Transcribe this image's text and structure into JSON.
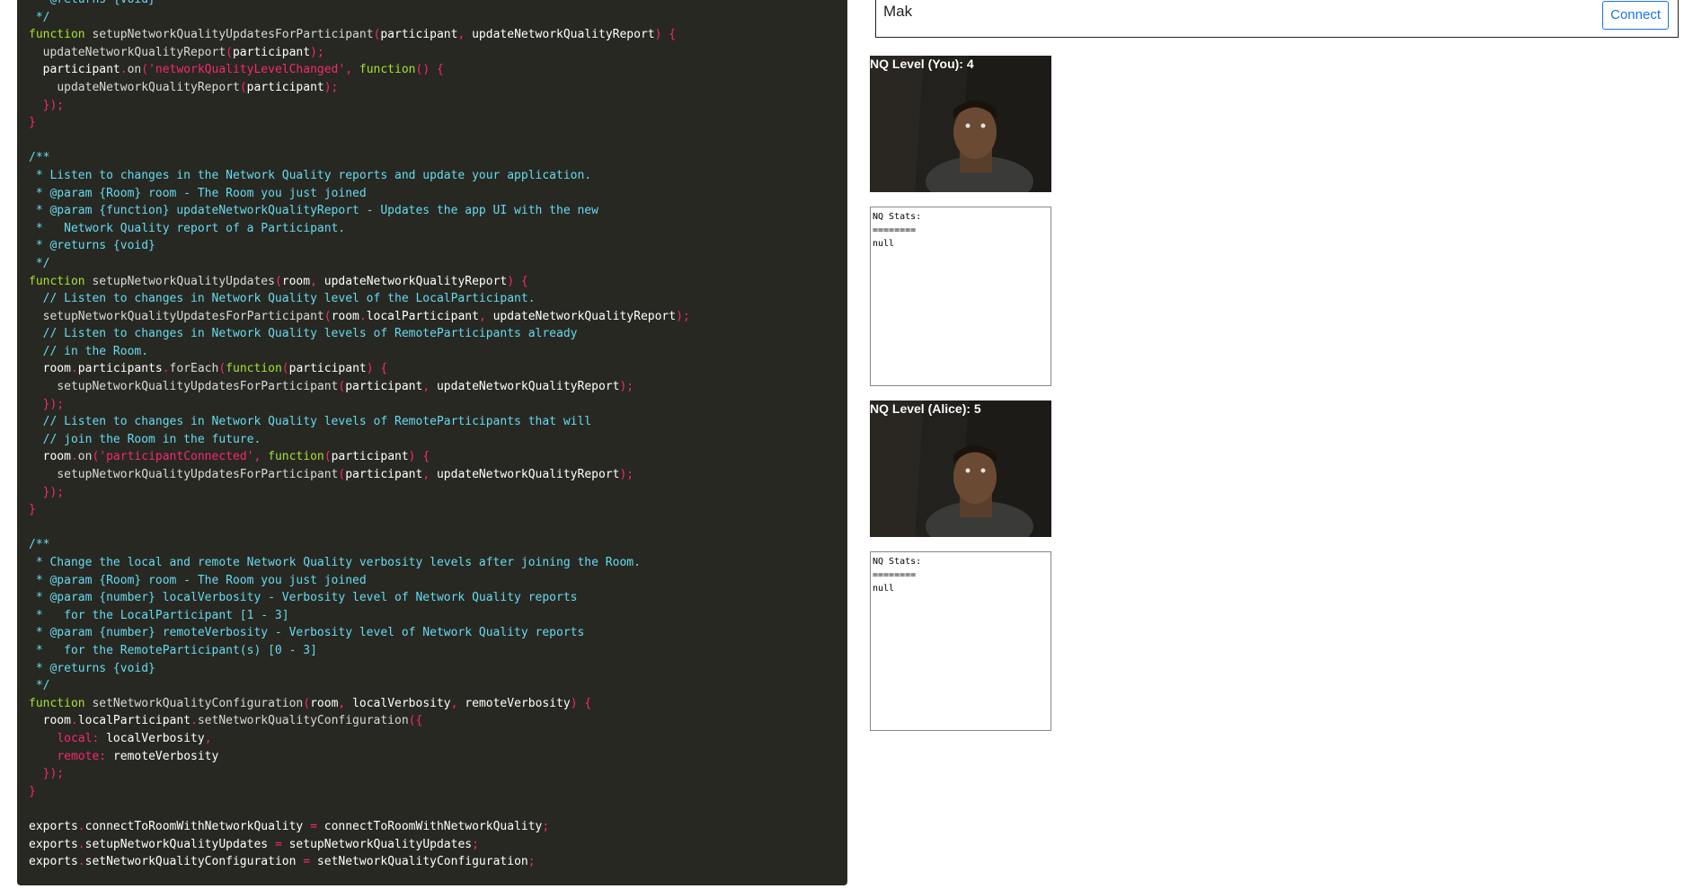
{
  "code_lines": [
    [
      [
        " * @returns {void}",
        "c"
      ]
    ],
    [
      [
        " */",
        "c"
      ]
    ],
    [
      [
        "function",
        "kw"
      ],
      [
        " ",
        ""
      ],
      [
        "setupNetworkQualityUpdatesForParticipant",
        "fn"
      ],
      [
        "(",
        "p"
      ],
      [
        "participant",
        "id"
      ],
      [
        ", ",
        "p"
      ],
      [
        "updateNetworkQualityReport",
        "id"
      ],
      [
        ") {",
        "p"
      ]
    ],
    [
      [
        "  ",
        ""
      ],
      [
        "updateNetworkQualityReport",
        "fn"
      ],
      [
        "(",
        "p"
      ],
      [
        "participant",
        "id"
      ],
      [
        ");",
        "p"
      ]
    ],
    [
      [
        "  ",
        ""
      ],
      [
        "participant",
        "id"
      ],
      [
        ".",
        "p"
      ],
      [
        "on",
        "fn"
      ],
      [
        "(",
        "p"
      ],
      [
        "'networkQualityLevelChanged'",
        "str"
      ],
      [
        ", ",
        "p"
      ],
      [
        "function",
        "kw"
      ],
      [
        "() {",
        "p"
      ]
    ],
    [
      [
        "    ",
        ""
      ],
      [
        "updateNetworkQualityReport",
        "fn"
      ],
      [
        "(",
        "p"
      ],
      [
        "participant",
        "id"
      ],
      [
        ");",
        "p"
      ]
    ],
    [
      [
        "  });",
        "p"
      ]
    ],
    [
      [
        "}",
        "p"
      ]
    ],
    [
      [
        "",
        ""
      ]
    ],
    [
      [
        "/**",
        "c"
      ]
    ],
    [
      [
        " * Listen to changes in the Network Quality reports and update your application.",
        "c"
      ]
    ],
    [
      [
        " * @param {Room} room - The Room you just joined",
        "c"
      ]
    ],
    [
      [
        " * @param {function} updateNetworkQualityReport - Updates the app UI with the new",
        "c"
      ]
    ],
    [
      [
        " *   Network Quality report of a Participant.",
        "c"
      ]
    ],
    [
      [
        " * @returns {void}",
        "c"
      ]
    ],
    [
      [
        " */",
        "c"
      ]
    ],
    [
      [
        "function",
        "kw"
      ],
      [
        " ",
        ""
      ],
      [
        "setupNetworkQualityUpdates",
        "fn"
      ],
      [
        "(",
        "p"
      ],
      [
        "room",
        "id"
      ],
      [
        ", ",
        "p"
      ],
      [
        "updateNetworkQualityReport",
        "id"
      ],
      [
        ") {",
        "p"
      ]
    ],
    [
      [
        "  // Listen to changes in Network Quality level of the LocalParticipant.",
        "c"
      ]
    ],
    [
      [
        "  ",
        ""
      ],
      [
        "setupNetworkQualityUpdatesForParticipant",
        "fn"
      ],
      [
        "(",
        "p"
      ],
      [
        "room",
        "id"
      ],
      [
        ".",
        "p"
      ],
      [
        "localParticipant",
        "id"
      ],
      [
        ", ",
        "p"
      ],
      [
        "updateNetworkQualityReport",
        "id"
      ],
      [
        ");",
        "p"
      ]
    ],
    [
      [
        "  // Listen to changes in Network Quality levels of RemoteParticipants already",
        "c"
      ]
    ],
    [
      [
        "  // in the Room.",
        "c"
      ]
    ],
    [
      [
        "  ",
        ""
      ],
      [
        "room",
        "id"
      ],
      [
        ".",
        "p"
      ],
      [
        "participants",
        "id"
      ],
      [
        ".",
        "p"
      ],
      [
        "forEach",
        "fn"
      ],
      [
        "(",
        "p"
      ],
      [
        "function",
        "kw"
      ],
      [
        "(",
        "p"
      ],
      [
        "participant",
        "id"
      ],
      [
        ") {",
        "p"
      ]
    ],
    [
      [
        "    ",
        ""
      ],
      [
        "setupNetworkQualityUpdatesForParticipant",
        "fn"
      ],
      [
        "(",
        "p"
      ],
      [
        "participant",
        "id"
      ],
      [
        ", ",
        "p"
      ],
      [
        "updateNetworkQualityReport",
        "id"
      ],
      [
        ");",
        "p"
      ]
    ],
    [
      [
        "  });",
        "p"
      ]
    ],
    [
      [
        "  // Listen to changes in Network Quality levels of RemoteParticipants that will",
        "c"
      ]
    ],
    [
      [
        "  // join the Room in the future.",
        "c"
      ]
    ],
    [
      [
        "  ",
        ""
      ],
      [
        "room",
        "id"
      ],
      [
        ".",
        "p"
      ],
      [
        "on",
        "fn"
      ],
      [
        "(",
        "p"
      ],
      [
        "'participantConnected'",
        "str"
      ],
      [
        ", ",
        "p"
      ],
      [
        "function",
        "kw"
      ],
      [
        "(",
        "p"
      ],
      [
        "participant",
        "id"
      ],
      [
        ") {",
        "p"
      ]
    ],
    [
      [
        "    ",
        ""
      ],
      [
        "setupNetworkQualityUpdatesForParticipant",
        "fn"
      ],
      [
        "(",
        "p"
      ],
      [
        "participant",
        "id"
      ],
      [
        ", ",
        "p"
      ],
      [
        "updateNetworkQualityReport",
        "id"
      ],
      [
        ");",
        "p"
      ]
    ],
    [
      [
        "  });",
        "p"
      ]
    ],
    [
      [
        "}",
        "p"
      ]
    ],
    [
      [
        "",
        ""
      ]
    ],
    [
      [
        "/**",
        "c"
      ]
    ],
    [
      [
        " * Change the local and remote Network Quality verbosity levels after joining the Room.",
        "c"
      ]
    ],
    [
      [
        " * @param {Room} room - The Room you just joined",
        "c"
      ]
    ],
    [
      [
        " * @param {number} localVerbosity - Verbosity level of Network Quality reports",
        "c"
      ]
    ],
    [
      [
        " *   for the LocalParticipant [1 - 3]",
        "c"
      ]
    ],
    [
      [
        " * @param {number} remoteVerbosity - Verbosity level of Network Quality reports",
        "c"
      ]
    ],
    [
      [
        " *   for the RemoteParticipant(s) [0 - 3]",
        "c"
      ]
    ],
    [
      [
        " * @returns {void}",
        "c"
      ]
    ],
    [
      [
        " */",
        "c"
      ]
    ],
    [
      [
        "function",
        "kw"
      ],
      [
        " ",
        ""
      ],
      [
        "setNetworkQualityConfiguration",
        "fn"
      ],
      [
        "(",
        "p"
      ],
      [
        "room",
        "id"
      ],
      [
        ", ",
        "p"
      ],
      [
        "localVerbosity",
        "id"
      ],
      [
        ", ",
        "p"
      ],
      [
        "remoteVerbosity",
        "id"
      ],
      [
        ") {",
        "p"
      ]
    ],
    [
      [
        "  ",
        ""
      ],
      [
        "room",
        "id"
      ],
      [
        ".",
        "p"
      ],
      [
        "localParticipant",
        "id"
      ],
      [
        ".",
        "p"
      ],
      [
        "setNetworkQualityConfiguration",
        "fn"
      ],
      [
        "({",
        "p"
      ]
    ],
    [
      [
        "    ",
        ""
      ],
      [
        "local:",
        "prop"
      ],
      [
        " ",
        ""
      ],
      [
        "localVerbosity",
        "id"
      ],
      [
        ",",
        "p"
      ]
    ],
    [
      [
        "    ",
        ""
      ],
      [
        "remote:",
        "prop"
      ],
      [
        " ",
        ""
      ],
      [
        "remoteVerbosity",
        "id"
      ]
    ],
    [
      [
        "  });",
        "p"
      ]
    ],
    [
      [
        "}",
        "p"
      ]
    ],
    [
      [
        "",
        ""
      ]
    ],
    [
      [
        "exports",
        "id"
      ],
      [
        ".",
        "p"
      ],
      [
        "connectToRoomWithNetworkQuality",
        "id"
      ],
      [
        " = ",
        "op"
      ],
      [
        "connectToRoomWithNetworkQuality",
        "id"
      ],
      [
        ";",
        "p"
      ]
    ],
    [
      [
        "exports",
        "id"
      ],
      [
        ".",
        "p"
      ],
      [
        "setupNetworkQualityUpdates",
        "id"
      ],
      [
        " = ",
        "op"
      ],
      [
        "setupNetworkQualityUpdates",
        "id"
      ],
      [
        ";",
        "p"
      ]
    ],
    [
      [
        "exports",
        "id"
      ],
      [
        ".",
        "p"
      ],
      [
        "setNetworkQualityConfiguration",
        "id"
      ],
      [
        " = ",
        "op"
      ],
      [
        "setNetworkQualityConfiguration",
        "id"
      ],
      [
        ";",
        "p"
      ]
    ]
  ],
  "connect_form": {
    "name_value": "Mak",
    "connect_label": "Connect"
  },
  "participants": [
    {
      "label": "NQ Level (You): 4",
      "stats": "NQ Stats:\n========\nnull"
    },
    {
      "label": "NQ Level (Alice): 5",
      "stats": "NQ Stats:\n========\nnull"
    }
  ],
  "colors": {
    "code_bg": "#272822",
    "button_accent": "#1a73e8"
  }
}
